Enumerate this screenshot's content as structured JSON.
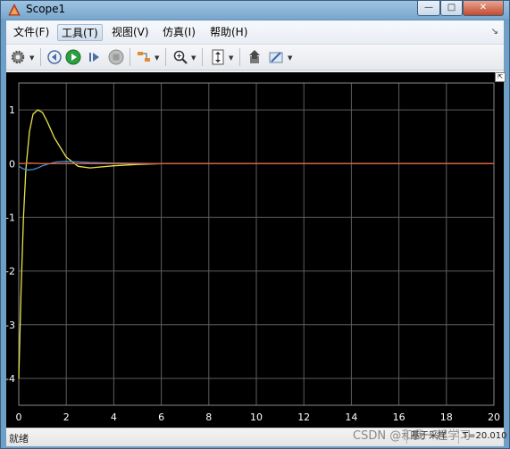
{
  "window": {
    "title": "Scope1",
    "min_glyph": "—",
    "max_glyph": "□",
    "close_glyph": "✕"
  },
  "menu": {
    "items": [
      "文件(F)",
      "工具(T)",
      "视图(V)",
      "仿真(I)",
      "帮助(H)"
    ],
    "active": "工具(T)",
    "overflow_glyph": "↘"
  },
  "toolbar": {
    "icons": [
      "settings-icon",
      "step-back-icon",
      "run-icon",
      "step-forward-icon",
      "stop-icon",
      "signal-select-icon",
      "zoom-icon",
      "scale-y-icon",
      "save-icon",
      "highlight-icon"
    ],
    "run_color": "#2ea043"
  },
  "undock_glyph": "⇱",
  "status": {
    "left": "就绪",
    "cell1": "基于采样",
    "cell2": "T=20.010"
  },
  "watermark": "CSDN @和我一起学习",
  "colors": {
    "background": "#000000",
    "grid": "#5e5e5e",
    "axis_text": "#ffffff"
  },
  "chart_data": {
    "type": "line",
    "xlim": [
      0,
      20
    ],
    "ylim": [
      -4.5,
      1.5
    ],
    "xticks": [
      0,
      2,
      4,
      6,
      8,
      10,
      12,
      14,
      16,
      18,
      20
    ],
    "yticks": [
      -4,
      -3,
      -2,
      -1,
      0,
      1
    ],
    "grid": true,
    "series": [
      {
        "color": "#e8e34a",
        "x": [
          0,
          0.1,
          0.2,
          0.3,
          0.45,
          0.6,
          0.8,
          1.0,
          1.2,
          1.5,
          2.0,
          2.5,
          3.0,
          4.0,
          5.0,
          6.0,
          8.0,
          20.0
        ],
        "y": [
          -4.0,
          -2.3,
          -1.0,
          -0.1,
          0.6,
          0.92,
          1.0,
          0.95,
          0.78,
          0.48,
          0.12,
          -0.05,
          -0.08,
          -0.04,
          -0.015,
          0,
          0,
          0
        ]
      },
      {
        "color": "#3f8fdc",
        "x": [
          0,
          0.2,
          0.4,
          0.6,
          0.8,
          1.0,
          1.3,
          1.6,
          2.0,
          2.5,
          3.0,
          4.0,
          6.0,
          20.0
        ],
        "y": [
          -0.05,
          -0.1,
          -0.12,
          -0.11,
          -0.08,
          -0.04,
          0.0,
          0.03,
          0.04,
          0.03,
          0.02,
          0.01,
          0,
          0
        ]
      },
      {
        "color": "#e0603a",
        "x": [
          0,
          0.5,
          1.0,
          2.0,
          20.0
        ],
        "y": [
          0,
          0.01,
          0.0,
          0.0,
          0
        ]
      }
    ]
  }
}
